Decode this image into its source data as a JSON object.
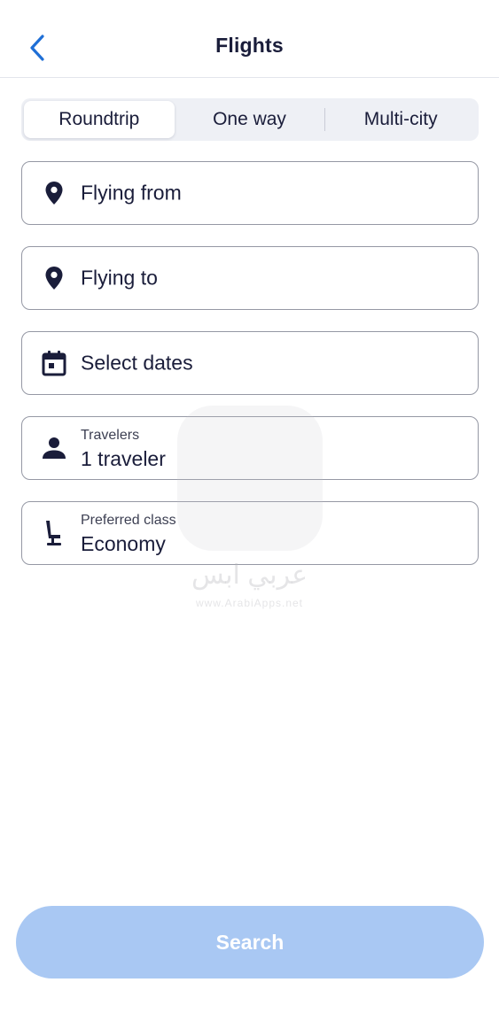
{
  "header": {
    "title": "Flights",
    "back_icon": "chevron-left-icon"
  },
  "trip_type": {
    "options": [
      "Roundtrip",
      "One way",
      "Multi-city"
    ],
    "selected": "Roundtrip"
  },
  "fields": {
    "origin": {
      "placeholder": "Flying from",
      "icon": "location-pin-icon"
    },
    "destination": {
      "placeholder": "Flying to",
      "icon": "location-pin-icon"
    },
    "dates": {
      "placeholder": "Select dates",
      "icon": "calendar-icon"
    },
    "travelers": {
      "label": "Travelers",
      "value": "1 traveler",
      "icon": "person-icon"
    },
    "cabin_class": {
      "label": "Preferred class",
      "value": "Economy",
      "icon": "seat-icon"
    }
  },
  "watermark": {
    "text": "عربي ابس",
    "url": "www.ArabiApps.net"
  },
  "search": {
    "label": "Search"
  },
  "colors": {
    "accent": "#1f6fd6",
    "text": "#1a1d3a",
    "border": "#9598a4",
    "search_disabled": "#a9c8f3",
    "segment_bg": "#eef0f5"
  }
}
